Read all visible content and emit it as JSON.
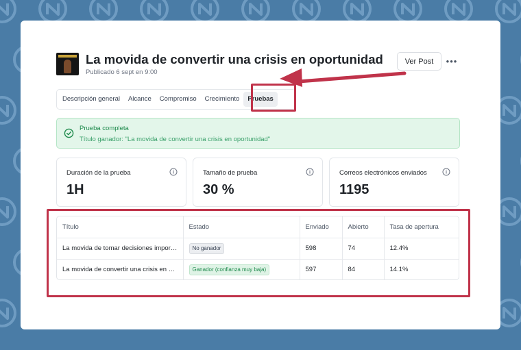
{
  "colors": {
    "background": "#4a7ca6",
    "accent_annotation": "#c0334a",
    "success_bg": "#e3f6ea",
    "success_text": "#1e8a4c"
  },
  "post": {
    "title": "La movida de convertir una crisis en oportunidad",
    "published": "Publicado 6 sept en 9:00",
    "view_button": "Ver Post",
    "more_icon": "ellipsis-icon"
  },
  "tabs": [
    {
      "label": "Descripción general",
      "active": false
    },
    {
      "label": "Alcance",
      "active": false
    },
    {
      "label": "Compromiso",
      "active": false
    },
    {
      "label": "Crecimiento",
      "active": false
    },
    {
      "label": "Pruebas",
      "active": true
    }
  ],
  "alert": {
    "title": "Prueba completa",
    "subtitle": "Título ganador: \"La movida de convertir una crisis en oportunidad\"",
    "icon": "check-circle-icon"
  },
  "stats": [
    {
      "label": "Duración de la prueba",
      "value": "1H"
    },
    {
      "label": "Tamaño de prueba",
      "value": "30 %"
    },
    {
      "label": "Correos electrónicos enviados",
      "value": "1195"
    }
  ],
  "table": {
    "columns": [
      "Título",
      "Estado",
      "Enviado",
      "Abierto",
      "Tasa de apertura"
    ],
    "rows": [
      {
        "title": "La movida de tomar decisiones importantes con confianza",
        "status": "No ganador",
        "sent": "598",
        "opened": "74",
        "rate": "12.4%"
      },
      {
        "title": "La movida de convertir una crisis en oportunidad",
        "status": "Ganador (confianza muy baja)",
        "sent": "597",
        "opened": "84",
        "rate": "14.1%"
      }
    ]
  }
}
